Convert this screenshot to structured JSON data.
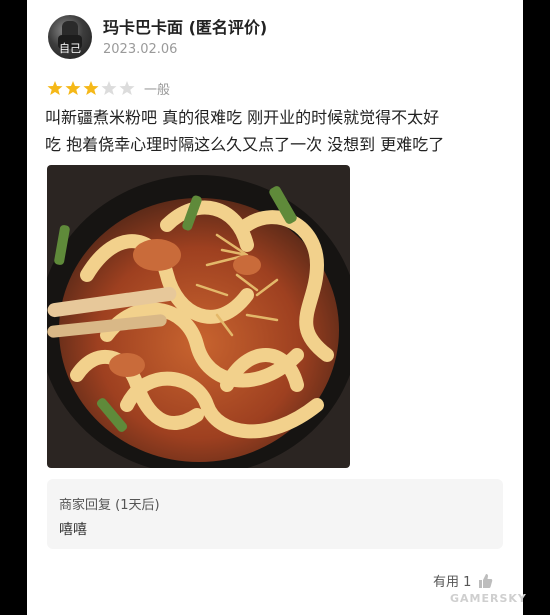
{
  "review": {
    "username": "玛卡巴卡面 (匿名评价)",
    "avatar_label": "自己",
    "date": "2023.02.06",
    "rating": 3,
    "rating_max": 5,
    "rating_label": "一般",
    "text_line1": "叫新疆煮米粉吧  真的很难吃 刚开业的时候就觉得不太好",
    "text_line2": "吃 抱着侥幸心理时隔这么久又点了一次 没想到 更难吃了",
    "photo_icon": "noodle-dish-photo"
  },
  "merchant_reply": {
    "title": "商家回复 (1天后)",
    "text": "嘻嘻"
  },
  "footer": {
    "useful_label": "有用 1",
    "useful_icon": "thumbs-up-icon",
    "watermark": "GAMERSKY"
  },
  "colors": {
    "star_active": "#f5b818",
    "star_inactive": "#dcdcdc",
    "reply_bg": "#f5f5f5"
  }
}
